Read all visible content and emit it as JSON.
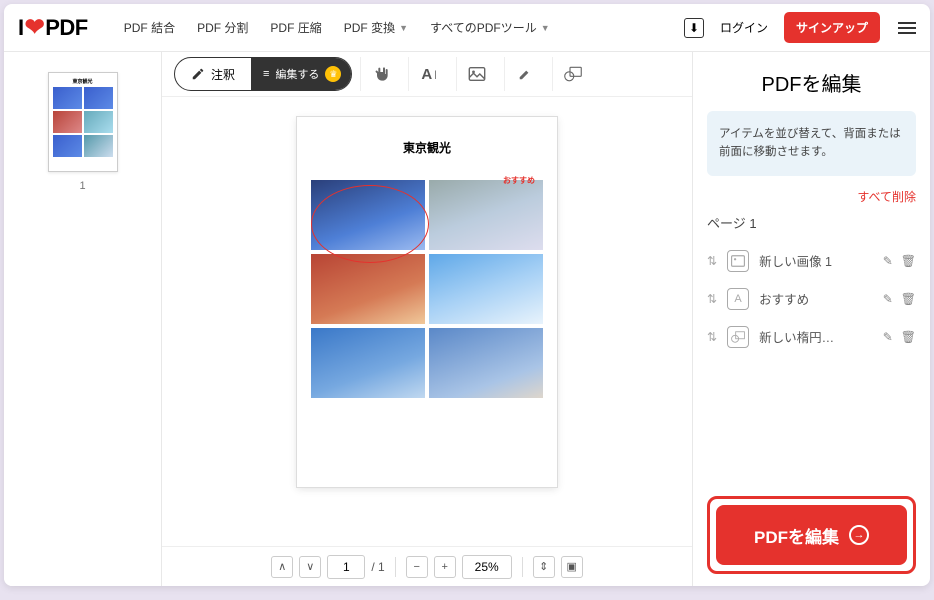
{
  "logo": {
    "left": "I",
    "right": "PDF"
  },
  "nav": {
    "merge": "PDF 結合",
    "split": "PDF 分割",
    "compress": "PDF 圧縮",
    "convert": "PDF 変換",
    "all_tools": "すべてのPDFツール"
  },
  "auth": {
    "login": "ログイン",
    "signup": "サインアップ"
  },
  "toolbar": {
    "annotate": "注釈",
    "edit": "編集する"
  },
  "page": {
    "title": "東京観光",
    "recommend": "おすすめ"
  },
  "thumbnail": {
    "number": "1"
  },
  "pager": {
    "current": "1",
    "total": "/ 1",
    "zoom": "25%"
  },
  "panel": {
    "title": "PDFを編集",
    "info": "アイテムを並び替えて、背面または前面に移動させます。",
    "delete_all": "すべて削除",
    "page_label": "ページ 1",
    "items": [
      {
        "label": "新しい画像 1"
      },
      {
        "label": "おすすめ"
      },
      {
        "label": "新しい楕円…"
      }
    ],
    "submit": "PDFを編集"
  }
}
